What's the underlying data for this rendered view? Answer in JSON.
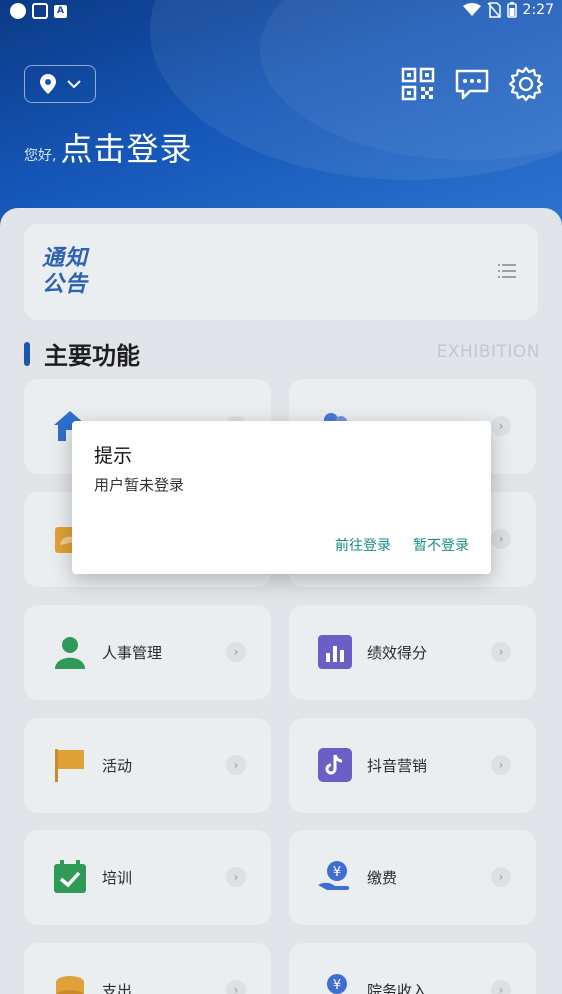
{
  "status_bar": {
    "time": "2:27",
    "app_badge": "A"
  },
  "header": {
    "greeting": "您好,",
    "login_prompt": "点击登录",
    "icons": [
      "location-icon",
      "chevron-down-icon",
      "qr-code-icon",
      "message-icon",
      "settings-icon"
    ]
  },
  "notice": {
    "logo_line1": "通知",
    "logo_line2": "公告"
  },
  "section": {
    "title": "主要功能",
    "subtitle": "EXHIBITION"
  },
  "features": [
    {
      "label": "",
      "icon": "home-icon"
    },
    {
      "label": "",
      "icon": "people-icon"
    },
    {
      "label": "",
      "icon": "box-icon"
    },
    {
      "label": "",
      "icon": "doc-icon"
    },
    {
      "label": "人事管理",
      "icon": "person-icon"
    },
    {
      "label": "绩效得分",
      "icon": "bar-chart-icon"
    },
    {
      "label": "活动",
      "icon": "flag-icon"
    },
    {
      "label": "抖音营销",
      "icon": "tiktok-icon"
    },
    {
      "label": "培训",
      "icon": "calendar-check-icon"
    },
    {
      "label": "缴费",
      "icon": "yen-hand-icon"
    },
    {
      "label": "支出",
      "icon": "coins-icon"
    },
    {
      "label": "院务收入",
      "icon": "yen-hand-icon"
    }
  ],
  "dialog": {
    "title": "提示",
    "message": "用户暂未登录",
    "confirm_label": "前往登录",
    "cancel_label": "暂不登录"
  },
  "colors": {
    "header_blue": "#1557b8",
    "accent_teal": "#1a8c87",
    "section_bar": "#1c55b0"
  }
}
